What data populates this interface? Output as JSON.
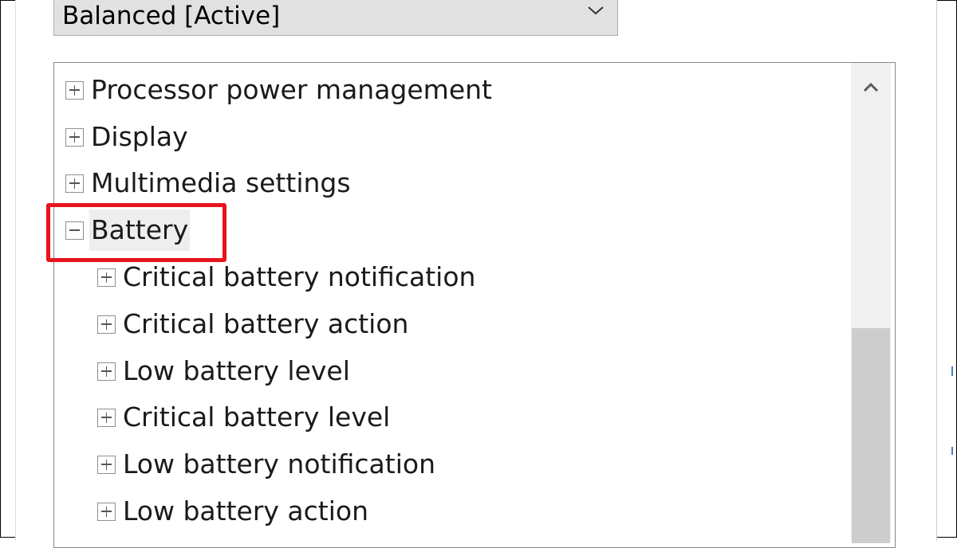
{
  "power_plan": {
    "selected_value": "Balanced [Active]"
  },
  "settings_tree": {
    "items": [
      {
        "label": "Processor power management",
        "level": 0,
        "expanded": false
      },
      {
        "label": "Display",
        "level": 0,
        "expanded": false
      },
      {
        "label": "Multimedia settings",
        "level": 0,
        "expanded": false
      },
      {
        "label": "Battery",
        "level": 0,
        "expanded": true,
        "selected": true
      },
      {
        "label": "Critical battery notification",
        "level": 1,
        "expanded": false
      },
      {
        "label": "Critical battery action",
        "level": 1,
        "expanded": false
      },
      {
        "label": "Low battery level",
        "level": 1,
        "expanded": false
      },
      {
        "label": "Critical battery level",
        "level": 1,
        "expanded": false
      },
      {
        "label": "Low battery notification",
        "level": 1,
        "expanded": false
      },
      {
        "label": "Low battery action",
        "level": 1,
        "expanded": false
      }
    ]
  },
  "annotation": {
    "highlight_color": "#e8141c",
    "highlighted_item": "Battery"
  },
  "icons": {
    "dropdown": "chevron-down-icon",
    "scroll_up": "chevron-up-icon",
    "expand": "plus-box-icon",
    "collapse": "minus-box-icon"
  },
  "colors": {
    "selection_background": "#eeeeee",
    "dropdown_background": "#e1e1e1",
    "scrollbar_track": "#f0f0f0",
    "scrollbar_thumb": "#cdcdcd"
  }
}
